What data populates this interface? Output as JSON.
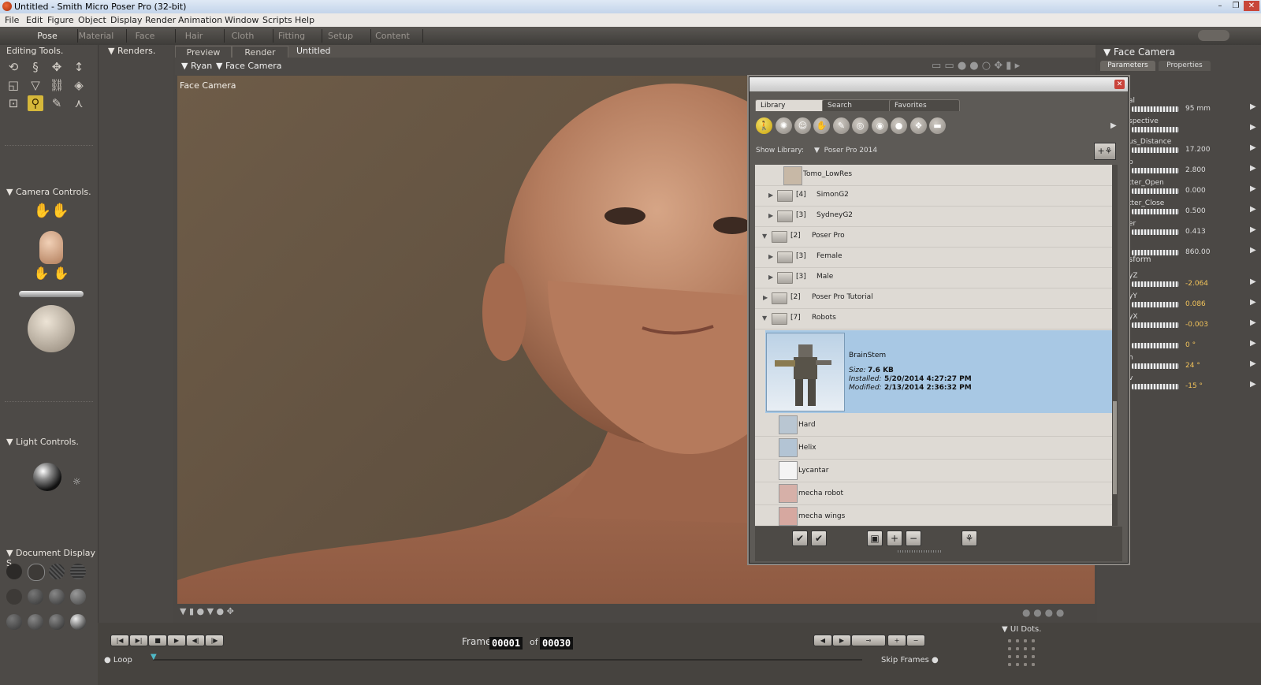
{
  "window": {
    "title": "Untitled - Smith Micro Poser Pro  (32-bit)",
    "controls": [
      "–",
      "❐",
      "✕"
    ]
  },
  "menu": [
    "File",
    "Edit",
    "Figure",
    "Object",
    "Display",
    "Render",
    "Animation",
    "Window",
    "Scripts",
    "Help"
  ],
  "rooms": [
    "Pose",
    "Material",
    "Face",
    "Hair",
    "Cloth",
    "Fitting",
    "Setup",
    "Content"
  ],
  "left": {
    "editing_tools": "Editing Tools.",
    "camera_controls": "Camera Controls.",
    "light_controls": "Light Controls.",
    "document_display": "Document Display S"
  },
  "renders": "Renders.",
  "doc_tabs": {
    "preview": "Preview",
    "render": "Render",
    "doc_title": "Untitled"
  },
  "viewport": {
    "figure": "Ryan",
    "camera": "Face Camera",
    "label": "Face Camera"
  },
  "right": {
    "camera_title": "Face Camera",
    "tab_parameters": "Parameters",
    "tab_properties": "Properties",
    "transform": "sform",
    "params": [
      {
        "label": "al",
        "value": "95 mm"
      },
      {
        "label": "spective",
        "value": ""
      },
      {
        "label": "us_Distance",
        "value": "17.200"
      },
      {
        "label": "p",
        "value": "2.800"
      },
      {
        "label": "tter_Open",
        "value": "0.000"
      },
      {
        "label": "tter_Close",
        "value": "0.500"
      },
      {
        "label": "er",
        "value": "0.413"
      },
      {
        "label": "",
        "value": "860.00"
      },
      {
        "label": "yZ",
        "value": "-2.064"
      },
      {
        "label": "yY",
        "value": "0.086"
      },
      {
        "label": "yX",
        "value": "-0.003"
      },
      {
        "label": "",
        "value": "0 °"
      },
      {
        "label": "h",
        "value": "24 °"
      },
      {
        "label": "v",
        "value": "-15 °"
      }
    ]
  },
  "timeline": {
    "frame_label": "Frame:",
    "frame": "00001",
    "of_label": "of",
    "total": "00030",
    "loop": "Loop",
    "skip_frames": "Skip Frames",
    "ui_dots": "UI Dots."
  },
  "library": {
    "tabs": [
      "Library",
      "Search",
      "Favorites"
    ],
    "show_library_label": "Show Library:",
    "show_library_value": "Poser Pro 2014",
    "items": [
      {
        "type": "item",
        "name": "Tomo_LowRes"
      },
      {
        "type": "folder",
        "count": "[4]",
        "name": "SimonG2",
        "open": false
      },
      {
        "type": "folder",
        "count": "[3]",
        "name": "SydneyG2",
        "open": false
      },
      {
        "type": "folder",
        "count": "[2]",
        "name": "Poser Pro",
        "open": true
      },
      {
        "type": "folder",
        "count": "[3]",
        "name": "Female",
        "open": false
      },
      {
        "type": "folder",
        "count": "[3]",
        "name": "Male",
        "open": false
      },
      {
        "type": "folder",
        "count": "[2]",
        "name": "Poser Pro Tutorial",
        "open": false
      },
      {
        "type": "folder",
        "count": "[7]",
        "name": "Robots",
        "open": true
      }
    ],
    "selected": {
      "name": "BrainStem",
      "size_label": "Size:",
      "size": "7.6 KB",
      "installed_label": "Installed:",
      "installed": "5/20/2014 4:27:27 PM",
      "modified_label": "Modified:",
      "modified": "2/13/2014 2:36:32 PM"
    },
    "children": [
      "Hard",
      "Helix",
      "Lycantar",
      "mecha robot",
      "mecha wings"
    ]
  },
  "colors": {
    "accent": "#d6b83a",
    "selection": "#a8c8e4"
  }
}
